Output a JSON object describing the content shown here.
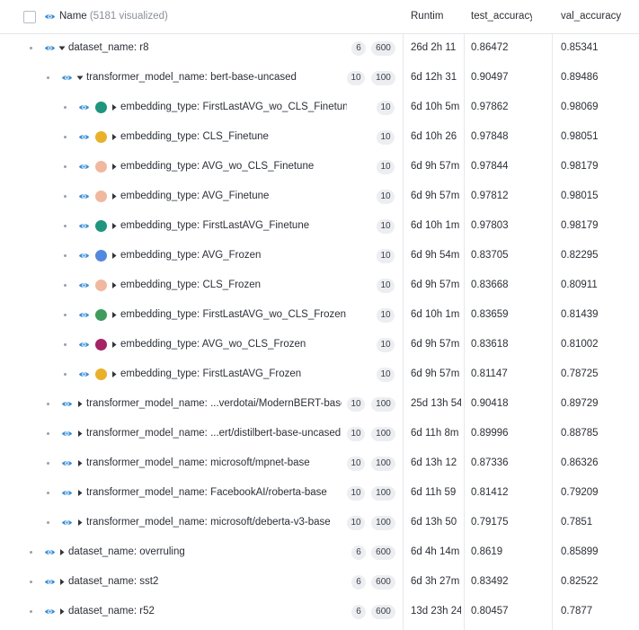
{
  "header": {
    "name_label": "Name",
    "visualized_count": "(5181 visualized)",
    "columns": [
      "Runtim",
      "test_accuracy",
      "val_accuracy"
    ]
  },
  "colors": {
    "eye": "#3a8fd6",
    "swatches": {
      "teal": "#20947e",
      "yellow": "#e9b12a",
      "peach": "#f0b89f",
      "blue": "#5389dd",
      "green": "#3f9b5d",
      "magenta": "#a42365"
    }
  },
  "rows": [
    {
      "level": 0,
      "expanded": true,
      "swatch": null,
      "key": "dataset_name: ",
      "value": "r8",
      "badge1": "6",
      "badge2": "600",
      "runtime": "26d 2h 11",
      "test": "0.86472",
      "val": "0.85341"
    },
    {
      "level": 1,
      "expanded": true,
      "swatch": null,
      "key": "transformer_model_name: ",
      "value": "bert-base-uncased",
      "badge1": "10",
      "badge2": "100",
      "runtime": "6d 12h 31",
      "test": "0.90497",
      "val": "0.89486"
    },
    {
      "level": 2,
      "expanded": false,
      "swatch": "teal",
      "key": "embedding_type: ",
      "value": "FirstLastAVG_wo_CLS_Finetune",
      "badge1": "10",
      "badge2": null,
      "runtime": "6d 10h 5m",
      "test": "0.97862",
      "val": "0.98069"
    },
    {
      "level": 2,
      "expanded": false,
      "swatch": "yellow",
      "key": "embedding_type: ",
      "value": "CLS_Finetune",
      "badge1": "10",
      "badge2": null,
      "runtime": "6d 10h 26",
      "test": "0.97848",
      "val": "0.98051"
    },
    {
      "level": 2,
      "expanded": false,
      "swatch": "peach",
      "key": "embedding_type: ",
      "value": "AVG_wo_CLS_Finetune",
      "badge1": "10",
      "badge2": null,
      "runtime": "6d 9h 57m",
      "test": "0.97844",
      "val": "0.98179"
    },
    {
      "level": 2,
      "expanded": false,
      "swatch": "peach",
      "key": "embedding_type: ",
      "value": "AVG_Finetune",
      "badge1": "10",
      "badge2": null,
      "runtime": "6d 9h 57m",
      "test": "0.97812",
      "val": "0.98015"
    },
    {
      "level": 2,
      "expanded": false,
      "swatch": "teal",
      "key": "embedding_type: ",
      "value": "FirstLastAVG_Finetune",
      "badge1": "10",
      "badge2": null,
      "runtime": "6d 10h 1m",
      "test": "0.97803",
      "val": "0.98179"
    },
    {
      "level": 2,
      "expanded": false,
      "swatch": "blue",
      "key": "embedding_type: ",
      "value": "AVG_Frozen",
      "badge1": "10",
      "badge2": null,
      "runtime": "6d 9h 54m",
      "test": "0.83705",
      "val": "0.82295"
    },
    {
      "level": 2,
      "expanded": false,
      "swatch": "peach",
      "key": "embedding_type: ",
      "value": "CLS_Frozen",
      "badge1": "10",
      "badge2": null,
      "runtime": "6d 9h 57m",
      "test": "0.83668",
      "val": "0.80911"
    },
    {
      "level": 2,
      "expanded": false,
      "swatch": "green",
      "key": "embedding_type: ",
      "value": "FirstLastAVG_wo_CLS_Frozen",
      "badge1": "10",
      "badge2": null,
      "runtime": "6d 10h 1m",
      "test": "0.83659",
      "val": "0.81439"
    },
    {
      "level": 2,
      "expanded": false,
      "swatch": "magenta",
      "key": "embedding_type: ",
      "value": "AVG_wo_CLS_Frozen",
      "badge1": "10",
      "badge2": null,
      "runtime": "6d 9h 57m",
      "test": "0.83618",
      "val": "0.81002"
    },
    {
      "level": 2,
      "expanded": false,
      "swatch": "yellow",
      "key": "embedding_type: ",
      "value": "FirstLastAVG_Frozen",
      "badge1": "10",
      "badge2": null,
      "runtime": "6d 9h 57m",
      "test": "0.81147",
      "val": "0.78725"
    },
    {
      "level": 1,
      "expanded": false,
      "swatch": null,
      "key": "transformer_model_name: ",
      "value": "...verdotai/ModernBERT-base",
      "badge1": "10",
      "badge2": "100",
      "runtime": "25d 13h 54",
      "test": "0.90418",
      "val": "0.89729"
    },
    {
      "level": 1,
      "expanded": false,
      "swatch": null,
      "key": "transformer_model_name: ",
      "value": "...ert/distilbert-base-uncased",
      "badge1": "10",
      "badge2": "100",
      "runtime": "6d 11h 8m",
      "test": "0.89996",
      "val": "0.88785"
    },
    {
      "level": 1,
      "expanded": false,
      "swatch": null,
      "key": "transformer_model_name: ",
      "value": "microsoft/mpnet-base",
      "badge1": "10",
      "badge2": "100",
      "runtime": "6d 13h 12",
      "test": "0.87336",
      "val": "0.86326"
    },
    {
      "level": 1,
      "expanded": false,
      "swatch": null,
      "key": "transformer_model_name: ",
      "value": "FacebookAI/roberta-base",
      "badge1": "10",
      "badge2": "100",
      "runtime": "6d 11h 59",
      "test": "0.81412",
      "val": "0.79209"
    },
    {
      "level": 1,
      "expanded": false,
      "swatch": null,
      "key": "transformer_model_name: ",
      "value": "microsoft/deberta-v3-base",
      "badge1": "10",
      "badge2": "100",
      "runtime": "6d 13h 50",
      "test": "0.79175",
      "val": "0.7851"
    },
    {
      "level": 0,
      "expanded": false,
      "swatch": null,
      "key": "dataset_name: ",
      "value": "overruling",
      "badge1": "6",
      "badge2": "600",
      "runtime": "6d 4h 14m",
      "test": "0.8619",
      "val": "0.85899"
    },
    {
      "level": 0,
      "expanded": false,
      "swatch": null,
      "key": "dataset_name: ",
      "value": "sst2",
      "badge1": "6",
      "badge2": "600",
      "runtime": "6d 3h 27m",
      "test": "0.83492",
      "val": "0.82522"
    },
    {
      "level": 0,
      "expanded": false,
      "swatch": null,
      "key": "dataset_name: ",
      "value": "r52",
      "badge1": "6",
      "badge2": "600",
      "runtime": "13d 23h 24",
      "test": "0.80457",
      "val": "0.7877"
    }
  ]
}
